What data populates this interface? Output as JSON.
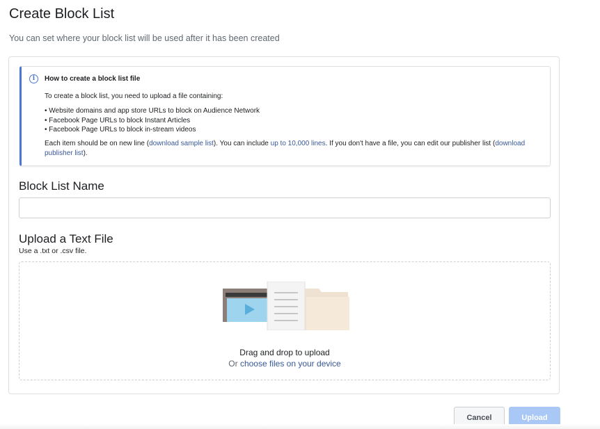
{
  "page": {
    "title": "Create Block List",
    "subtitle": "You can set where your block list will be used after it has been created"
  },
  "info": {
    "icon": "info-icon",
    "title": "How to create a block list file",
    "intro": "To create a block list, you need to upload a file containing:",
    "items": [
      "Website domains and app store URLs to block on Audience Network",
      "Facebook Page URLs to block Instant Articles",
      "Facebook Page URLs to block in-stream videos"
    ],
    "footer": {
      "t1": "Each item should be on new line (",
      "link_sample": "download sample list",
      "t2": "). You can include ",
      "link_limit": "up to 10,000 lines",
      "t3": ". If you don't have a file, you can edit our publisher list (",
      "link_publisher": "download publisher list",
      "t4": ")."
    }
  },
  "name_section": {
    "title": "Block List Name",
    "input_value": "",
    "placeholder": ""
  },
  "upload_section": {
    "title": "Upload a Text File",
    "hint": "Use a .txt or .csv file.",
    "drop_text": "Drag and drop to upload",
    "or_text": "Or ",
    "choose_link": "choose files on your device",
    "illustration_icon": "files-illustration-icon"
  },
  "buttons": {
    "cancel": "Cancel",
    "upload": "Upload"
  },
  "colors": {
    "accent": "#4a76d4",
    "link": "#385898",
    "upload_disabled": "#a9c8f5"
  }
}
